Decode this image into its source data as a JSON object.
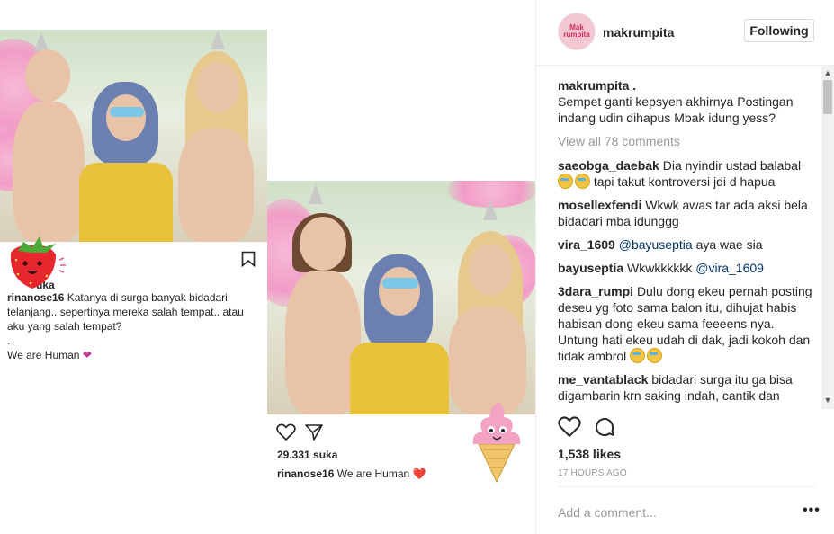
{
  "card1": {
    "likes_partial": "uka",
    "username": "rinanose16",
    "caption": "Katanya di surga banyak bidadari telanjang.. sepertinya mereka salah tempat.. atau aku yang salah tempat?",
    "dot": ".",
    "tagline": "We are Human",
    "heart": "❤"
  },
  "card2": {
    "likes": "29.331 suka",
    "username": "rinanose16",
    "caption": "We are Human",
    "heart": "❤️"
  },
  "post": {
    "avatar_text_1": "Mak",
    "avatar_text_2": "rumpita",
    "username": "makrumpita",
    "follow_label": "Following",
    "caption_user": "makrumpita .",
    "caption_text": "Sempet ganti kepsyen akhirnya Postingan indang udin dihapus Mbak idung yess?",
    "view_all": "View all 78 comments",
    "comments": [
      {
        "user": "saeobga_daebak",
        "text": "Dia nyindir ustad balabal",
        "text2": "tapi takut kontroversi jdi d hapua"
      },
      {
        "user": "mosellexfendi",
        "text": "Wkwk awas tar ada aksi bela bidadari mba idunggg"
      },
      {
        "user": "vira_1609",
        "mention": "@bayuseptia",
        "text": "aya wae sia"
      },
      {
        "user": "bayuseptia",
        "text": "Wkwkkkkkk",
        "mention": "@vira_1609"
      },
      {
        "user": "3dara_rumpi",
        "text": "Dulu dong ekeu pernah posting deseu yg foto sama balon itu, dihujat habis habisan dong ekeu sama feeeens nya. Untung hati ekeu udah di dak, jadi kokoh dan tidak ambrol"
      },
      {
        "user": "me_vantablack",
        "text": "bidadari surga itu ga bisa digambarin krn saking indah, cantik dan sempurna. kalo bidadari surga menatap"
      }
    ],
    "likes": "1,538 likes",
    "time": "17 HOURS AGO",
    "add_comment_placeholder": "Add a comment...",
    "more": "•••"
  },
  "icons": [
    "heart-icon",
    "comment-icon",
    "send-icon",
    "bookmark-icon",
    "more-options-icon",
    "strawberry-sticker",
    "ice-cream-sticker"
  ],
  "colors": {
    "following_border": "#dbdbdb",
    "muted": "#999999",
    "mention": "#003569",
    "heart_purple": "#c2388f"
  }
}
